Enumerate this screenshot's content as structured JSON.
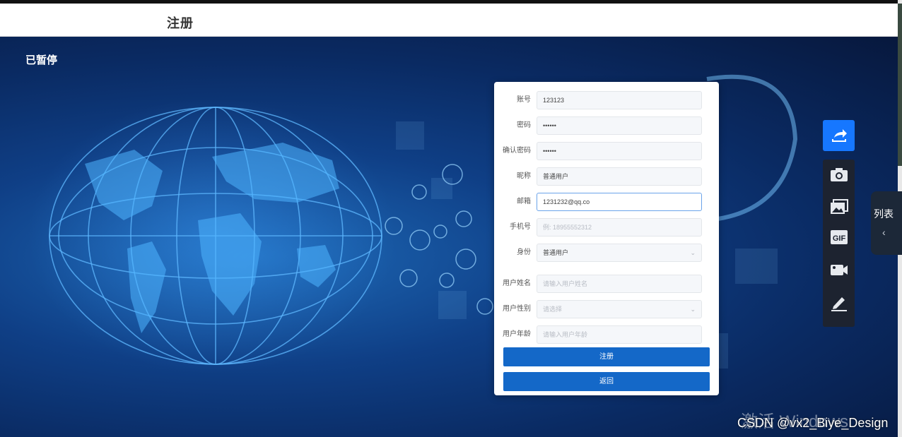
{
  "header": {
    "title": "注册"
  },
  "overlay": {
    "paused": "已暂停"
  },
  "form": {
    "account_label": "账号",
    "account_value": "123123",
    "password_label": "密码",
    "password_value": "••••••",
    "confirm_label": "确认密码",
    "confirm_value": "••••••",
    "nickname_label": "昵称",
    "nickname_value": "普通用户",
    "email_label": "邮箱",
    "email_value": "1231232@qq.co",
    "phone_label": "手机号",
    "phone_placeholder": "例: 18955552312",
    "identity_label": "身份",
    "identity_value": "普通用户",
    "username_label": "用户姓名",
    "username_placeholder": "请输入用户姓名",
    "gender_label": "用户性别",
    "gender_placeholder": "请选择",
    "age_label": "用户年龄",
    "age_placeholder": "请输入用户年龄",
    "register_button": "注册",
    "back_button": "返回"
  },
  "side_panel": {
    "label": "列表",
    "chevron": "‹"
  },
  "toolbar": {
    "icons": [
      "share-icon",
      "camera-icon",
      "gallery-icon",
      "gif-icon",
      "video-icon",
      "pen-icon"
    ]
  },
  "watermark": {
    "activate": "激活 Windows",
    "csdn": "CSDN @vx2_Biye_Design"
  },
  "colors": {
    "primary_button": "#1468c8",
    "toolbar_active": "#1677ff",
    "toolbar_bg": "#1d2330"
  }
}
